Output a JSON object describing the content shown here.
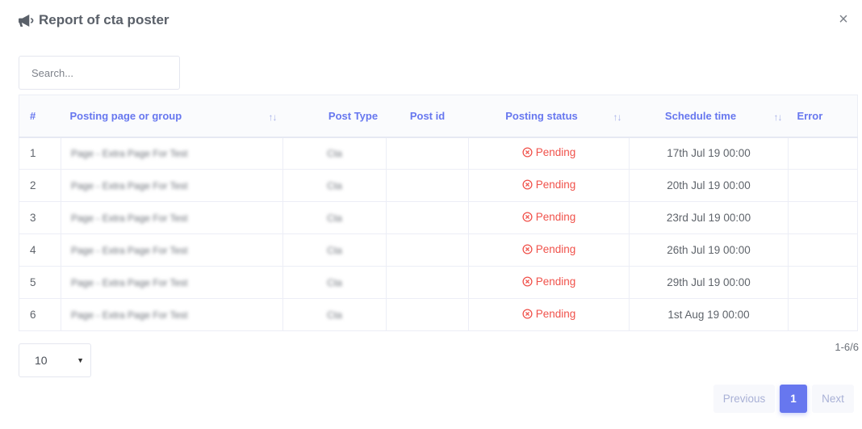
{
  "modal": {
    "title": "Report of cta poster"
  },
  "search": {
    "placeholder": "Search..."
  },
  "table": {
    "columns": [
      "#",
      "Posting page or group",
      "Post Type",
      "Post id",
      "Posting status",
      "Schedule time",
      "Error"
    ],
    "sort_symbol": "↑↓",
    "rows": [
      {
        "num": "1",
        "page": "Page - Extra Page For Test",
        "type": "Cta",
        "post_id": "",
        "status": "Pending",
        "schedule": "17th Jul 19 00:00",
        "error": ""
      },
      {
        "num": "2",
        "page": "Page - Extra Page For Test",
        "type": "Cta",
        "post_id": "",
        "status": "Pending",
        "schedule": "20th Jul 19 00:00",
        "error": ""
      },
      {
        "num": "3",
        "page": "Page - Extra Page For Test",
        "type": "Cta",
        "post_id": "",
        "status": "Pending",
        "schedule": "23rd Jul 19 00:00",
        "error": ""
      },
      {
        "num": "4",
        "page": "Page - Extra Page For Test",
        "type": "Cta",
        "post_id": "",
        "status": "Pending",
        "schedule": "26th Jul 19 00:00",
        "error": ""
      },
      {
        "num": "5",
        "page": "Page - Extra Page For Test",
        "type": "Cta",
        "post_id": "",
        "status": "Pending",
        "schedule": "29th Jul 19 00:00",
        "error": ""
      },
      {
        "num": "6",
        "page": "Page - Extra Page For Test",
        "type": "Cta",
        "post_id": "",
        "status": "Pending",
        "schedule": "1st Aug 19 00:00",
        "error": ""
      }
    ]
  },
  "footer": {
    "per_page": "10",
    "range": "1-6/6",
    "pagination": {
      "prev": "Previous",
      "current": "1",
      "next": "Next"
    }
  },
  "colors": {
    "accent": "#6777ef",
    "pending": "#f0524b"
  },
  "icons": {
    "title": "bullhorn-icon",
    "close": "close-icon",
    "status": "times-circle-icon",
    "sort": "sort-icon",
    "select": "caret-down-icon"
  }
}
